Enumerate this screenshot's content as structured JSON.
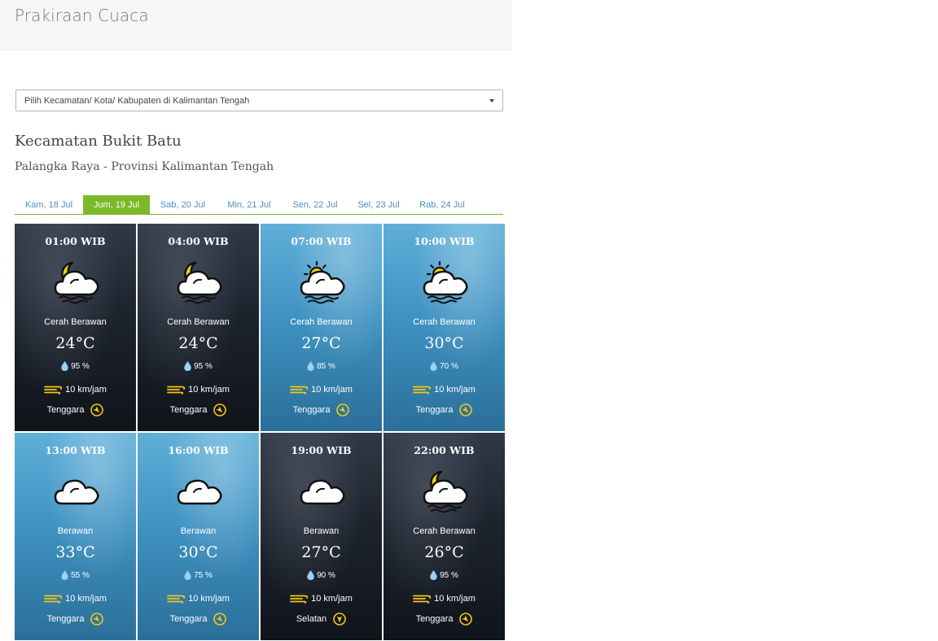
{
  "header": {
    "title": "Prakiraan Cuaca"
  },
  "select": {
    "text": "Pilih Kecamatan/ Kota/ Kabupaten di Kalimantan Tengah"
  },
  "location": {
    "name": "Kecamatan Bukit Batu",
    "subtitle": "Palangka Raya - Provinsi Kalimantan Tengah"
  },
  "colors": {
    "accent": "#7ab929",
    "tab_text": "#4a8fc4",
    "wind_icon": "#f5c518"
  },
  "tabs": [
    {
      "label": "Kam, 18 Jul",
      "active": false
    },
    {
      "label": "Jum, 19 Jul",
      "active": true
    },
    {
      "label": "Sab, 20 Jul",
      "active": false
    },
    {
      "label": "Min, 21 Jul",
      "active": false
    },
    {
      "label": "Sen, 22 Jul",
      "active": false
    },
    {
      "label": "Sel, 23 Jul",
      "active": false
    },
    {
      "label": "Rab, 24 Jul",
      "active": false
    }
  ],
  "forecast": [
    {
      "time": "01:00 WIB",
      "theme": "night",
      "icon": "moon-cloud-icon",
      "desc": "Cerah Berawan",
      "temp": "24°C",
      "humidity": "95 %",
      "wind": "10 km/jam",
      "direction": "Tenggara",
      "dir_icon": "arrow-southeast-icon"
    },
    {
      "time": "04:00 WIB",
      "theme": "night",
      "icon": "moon-cloud-icon",
      "desc": "Cerah Berawan",
      "temp": "24°C",
      "humidity": "95 %",
      "wind": "10 km/jam",
      "direction": "Tenggara",
      "dir_icon": "arrow-southeast-icon"
    },
    {
      "time": "07:00 WIB",
      "theme": "day",
      "icon": "sun-cloud-icon",
      "desc": "Cerah Berawan",
      "temp": "27°C",
      "humidity": "85 %",
      "wind": "10 km/jam",
      "direction": "Tenggara",
      "dir_icon": "arrow-southeast-icon"
    },
    {
      "time": "10:00 WIB",
      "theme": "day",
      "icon": "sun-cloud-icon",
      "desc": "Cerah Berawan",
      "temp": "30°C",
      "humidity": "70 %",
      "wind": "10 km/jam",
      "direction": "Tenggara",
      "dir_icon": "arrow-southeast-icon"
    },
    {
      "time": "13:00 WIB",
      "theme": "day",
      "icon": "cloud-icon",
      "desc": "Berawan",
      "temp": "33°C",
      "humidity": "55 %",
      "wind": "10 km/jam",
      "direction": "Tenggara",
      "dir_icon": "arrow-southeast-icon"
    },
    {
      "time": "16:00 WIB",
      "theme": "day",
      "icon": "cloud-icon",
      "desc": "Berawan",
      "temp": "30°C",
      "humidity": "75 %",
      "wind": "10 km/jam",
      "direction": "Tenggara",
      "dir_icon": "arrow-southeast-icon"
    },
    {
      "time": "19:00 WIB",
      "theme": "night",
      "icon": "cloud-icon",
      "desc": "Berawan",
      "temp": "27°C",
      "humidity": "90 %",
      "wind": "10 km/jam",
      "direction": "Selatan",
      "dir_icon": "arrow-south-icon"
    },
    {
      "time": "22:00 WIB",
      "theme": "night",
      "icon": "moon-cloud-icon",
      "desc": "Cerah Berawan",
      "temp": "26°C",
      "humidity": "95 %",
      "wind": "10 km/jam",
      "direction": "Tenggara",
      "dir_icon": "arrow-southeast-icon"
    }
  ]
}
